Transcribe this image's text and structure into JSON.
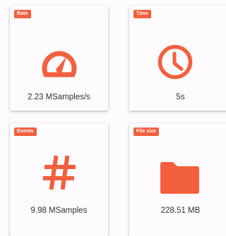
{
  "theme": {
    "accent": "#f2603d",
    "card_bg": "#fdfbfd",
    "text": "#333333"
  },
  "cards": [
    {
      "badge": "Rate",
      "icon": "speedometer-icon",
      "value": "2.23 MSamples/s"
    },
    {
      "badge": "Time",
      "icon": "clock-icon",
      "value": "5s"
    },
    {
      "badge": "Events",
      "icon": "hash-icon",
      "value": "9.98 MSamples"
    },
    {
      "badge": "File size",
      "icon": "folder-icon",
      "value": "228.51 MB"
    }
  ]
}
